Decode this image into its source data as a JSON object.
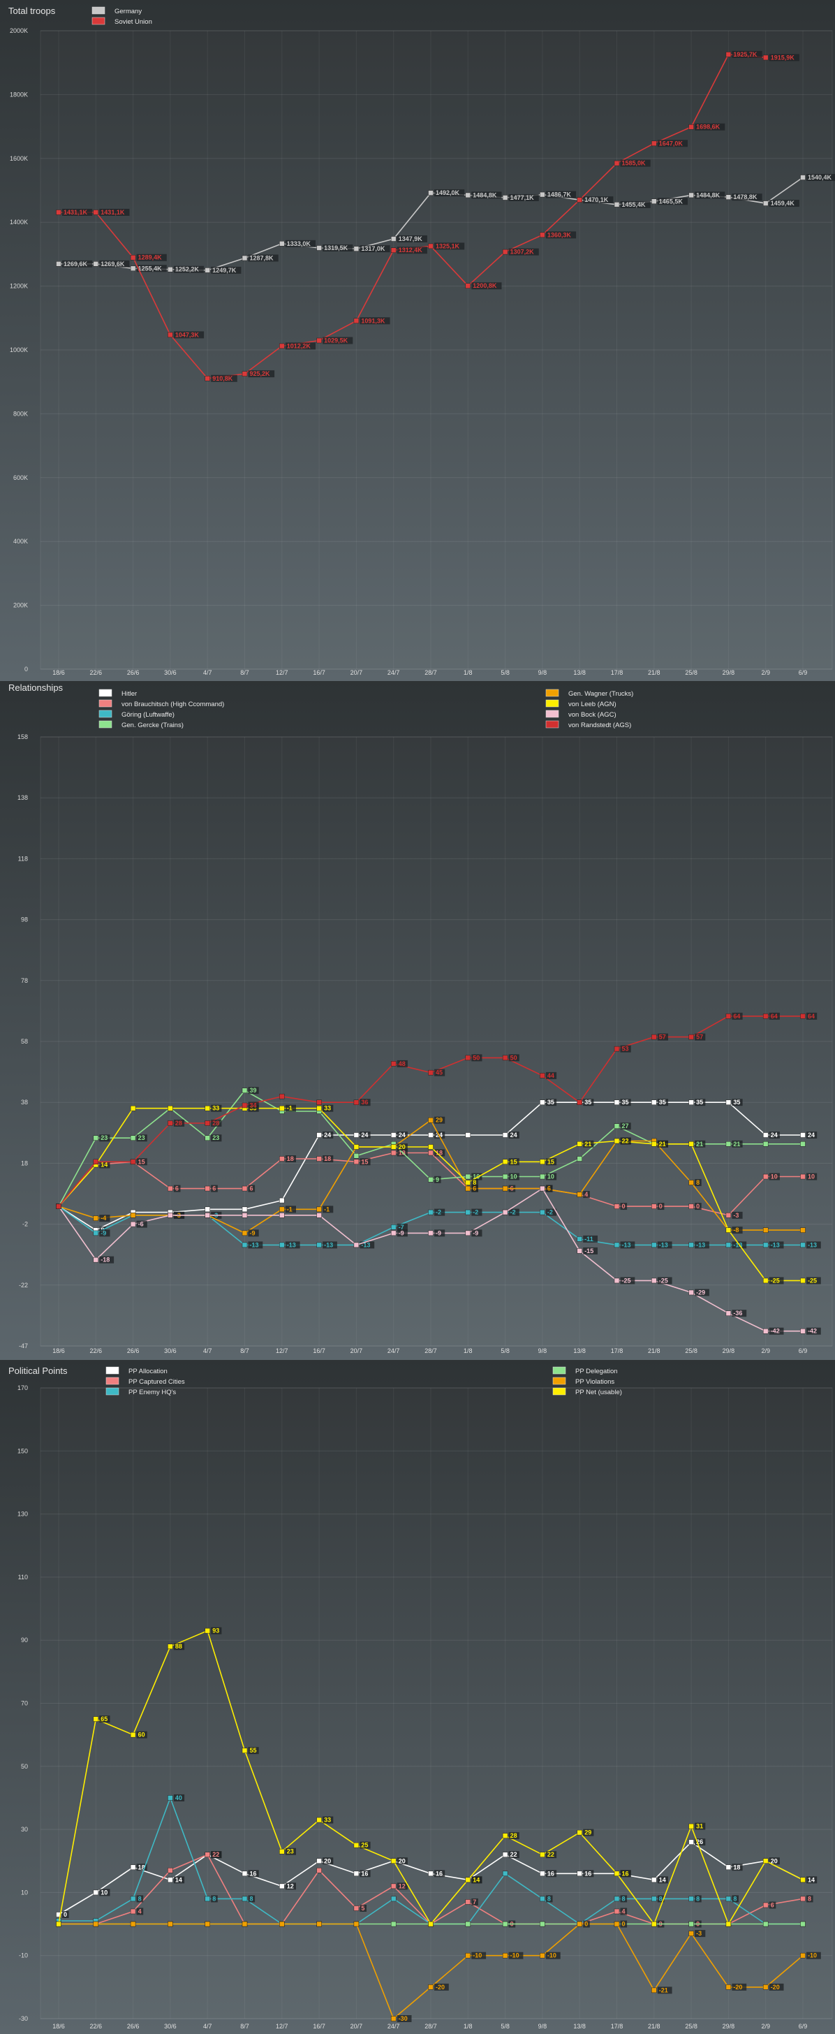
{
  "chart_data": [
    {
      "type": "line",
      "title": "Total troops",
      "categories": [
        "18/6",
        "22/6",
        "26/6",
        "30/6",
        "4/7",
        "8/7",
        "12/7",
        "16/7",
        "20/7",
        "24/7",
        "28/7",
        "1/8",
        "5/8",
        "9/8",
        "13/8",
        "17/8",
        "21/8",
        "25/8",
        "29/8",
        "2/9",
        "6/9"
      ],
      "y_ticks": [
        "2000K",
        "1800K",
        "1600K",
        "1400K",
        "1200K",
        "1000K",
        "800K",
        "600K",
        "400K",
        "200K",
        "0"
      ],
      "ylim": [
        0,
        2000
      ],
      "legend_position": "top-left",
      "series": [
        {
          "name": "Germany",
          "color": "#c8c8c8",
          "values": [
            1269.6,
            1269.6,
            1255.4,
            1252.2,
            1249.7,
            1287.8,
            1333.0,
            1319.5,
            1317.0,
            1347.9,
            1492.0,
            1484.8,
            1477.1,
            1486.7,
            1470.1,
            1455.4,
            1465.5,
            1484.8,
            1478.8,
            1459.4,
            1540.4
          ],
          "labels": [
            "1269,6K",
            "1269,6K",
            "1255,4K",
            "1252,2K",
            "1249,7K",
            "1287,8K",
            "1333,0K",
            "1319,5K",
            "1317,0K",
            "1347,9K",
            "1492,0K",
            "1484,8K",
            "1477,1K",
            "1486,7K",
            "1470,1K",
            "1455,4K",
            "1465,5K",
            "1484,8K",
            "1478,8K",
            "1459,4K",
            "1540,4K"
          ]
        },
        {
          "name": "Soviet Union",
          "color": "#d93a3a",
          "values": [
            1431.1,
            1431.1,
            1289.4,
            1047.3,
            910.8,
            925.2,
            1012.2,
            1029.5,
            1091.3,
            1312.4,
            1325.1,
            1200.8,
            1307.2,
            1360.3,
            1470.1,
            1585.0,
            1647.0,
            1698.6,
            1925.7,
            1915.9,
            null
          ],
          "labels": [
            "1431,1K",
            "1431,1K",
            "1289,4K",
            "1047,3K",
            "910,8K",
            "925,2K",
            "1012,2K",
            "1029,5K",
            "1091,3K",
            "1312,4K",
            "1325,1K",
            "1200,8K",
            "1307,2K",
            "1360,3K",
            "",
            "1585,0K",
            "1647,0K",
            "1698,6K",
            "1925,7K",
            "1915,9K",
            ""
          ]
        }
      ]
    },
    {
      "type": "line",
      "title": "Relationships",
      "categories": [
        "18/6",
        "22/6",
        "26/6",
        "30/6",
        "4/7",
        "8/7",
        "12/7",
        "16/7",
        "20/7",
        "24/7",
        "28/7",
        "1/8",
        "5/8",
        "9/8",
        "13/8",
        "17/8",
        "21/8",
        "25/8",
        "29/8",
        "2/9",
        "6/9"
      ],
      "y_ticks": [
        "158",
        "138",
        "118",
        "98",
        "78",
        "58",
        "38",
        "18",
        "-2",
        "-22",
        "-47"
      ],
      "ylim": [
        -47,
        158
      ],
      "legend_position": "top",
      "series": [
        {
          "name": "Hitler",
          "color": "#ffffff",
          "values": [
            0,
            -8,
            -2,
            -2,
            -1,
            -1,
            2,
            24,
            24,
            24,
            24,
            24,
            24,
            35,
            35,
            35,
            35,
            35,
            35,
            24,
            24
          ],
          "labels": [
            "",
            "8",
            "",
            "",
            "",
            "",
            "",
            "24",
            "24",
            "24",
            "24",
            "",
            "24",
            "35",
            "35",
            "35",
            "35",
            "35",
            "35",
            "24",
            "24"
          ]
        },
        {
          "name": "von Brauchitsch (High Ccommand)",
          "color": "#f08080",
          "values": [
            0,
            14,
            15,
            6,
            6,
            6,
            16,
            16,
            15,
            18,
            18,
            6,
            6,
            6,
            4,
            0,
            0,
            0,
            -3,
            10,
            10
          ],
          "labels": [
            "",
            "",
            "15",
            "6",
            "6",
            "6",
            "18",
            "18",
            "15",
            "18",
            "18",
            "6",
            "6",
            "6",
            "4",
            "0",
            "0",
            "0",
            "-3",
            "10",
            "10"
          ]
        },
        {
          "name": "Göring (Luftwaffe)",
          "color": "#3fb9c5",
          "values": [
            0,
            -9,
            -3,
            -3,
            -3,
            -13,
            -13,
            -13,
            -13,
            -7,
            -2,
            -2,
            -2,
            -2,
            -11,
            -13,
            -13,
            -13,
            -13,
            -13,
            -13
          ],
          "labels": [
            "",
            "-9",
            "",
            "-3",
            "-3",
            "-13",
            "-13",
            "-13",
            "-13",
            "-7",
            "-2",
            "-2",
            "-2",
            "-2",
            "-11",
            "-13",
            "-13",
            "-13",
            "-13",
            "-13",
            "-13"
          ]
        },
        {
          "name": "Gen. Gercke (Trains)",
          "color": "#8ee28e",
          "values": [
            0,
            23,
            23,
            33,
            23,
            39,
            32,
            32,
            17,
            21,
            9,
            10,
            10,
            10,
            16,
            27,
            21,
            21,
            21,
            21,
            21
          ],
          "labels": [
            "",
            "23",
            "23",
            "",
            "23",
            "39",
            "",
            "",
            "",
            "",
            "9",
            "10",
            "10",
            "10",
            "",
            "27",
            "21",
            "21",
            "21",
            "",
            ""
          ]
        },
        {
          "name": "Gen. Wagner (Trucks)",
          "color": "#f0a000",
          "values": [
            0,
            -4,
            -3,
            -3,
            -3,
            -9,
            -1,
            -1,
            20,
            20,
            29,
            6,
            6,
            6,
            4,
            22,
            22,
            8,
            -8,
            -8,
            -8
          ],
          "labels": [
            "",
            "-4",
            "",
            "-3",
            "",
            "-9",
            "-1",
            "-1",
            "",
            "",
            "29",
            "6",
            "",
            "6",
            "",
            "22",
            "",
            "8",
            "-8",
            "",
            ""
          ]
        },
        {
          "name": "von Leeb (AGN)",
          "color": "#ffee00",
          "values": [
            0,
            14,
            33,
            33,
            33,
            33,
            33,
            33,
            20,
            20,
            20,
            8,
            15,
            15,
            21,
            22,
            21,
            21,
            -8,
            -25,
            -25
          ],
          "labels": [
            "",
            "14",
            "",
            "",
            "33",
            "33",
            "-1",
            "33",
            "",
            "20",
            "",
            "8",
            "15",
            "15",
            "21",
            "22",
            "21",
            "",
            "",
            "-25",
            "-25"
          ]
        },
        {
          "name": "von Bock (AGC)",
          "color": "#f2c0d0",
          "values": [
            0,
            -18,
            -6,
            -3,
            -3,
            -3,
            -3,
            -3,
            -13,
            -9,
            -9,
            -9,
            -2,
            6,
            -15,
            -25,
            -25,
            -29,
            -36,
            -42,
            -42
          ],
          "labels": [
            "",
            "-18",
            "-6",
            "",
            "",
            "",
            "",
            "",
            "",
            "-9",
            "-9",
            "-9",
            "",
            "",
            "-15",
            "-25",
            "-25",
            "-29",
            "-36",
            "-42",
            "-42"
          ]
        },
        {
          "name": "von Randstedt (AGS)",
          "color": "#d03030",
          "values": [
            0,
            15,
            15,
            28,
            28,
            34,
            37,
            35,
            35,
            48,
            45,
            50,
            50,
            44,
            35,
            53,
            57,
            57,
            64,
            64,
            64
          ],
          "labels": [
            "",
            "",
            "",
            "28",
            "28",
            "34",
            "",
            "",
            "36",
            "48",
            "45",
            "50",
            "50",
            "44",
            "",
            "53",
            "57",
            "57",
            "64",
            "64",
            "64"
          ]
        }
      ]
    },
    {
      "type": "line",
      "title": "Political Points",
      "categories": [
        "18/6",
        "22/6",
        "26/6",
        "30/6",
        "4/7",
        "8/7",
        "12/7",
        "16/7",
        "20/7",
        "24/7",
        "28/7",
        "1/8",
        "5/8",
        "9/8",
        "13/8",
        "17/8",
        "21/8",
        "25/8",
        "29/8",
        "2/9",
        "6/9"
      ],
      "y_ticks": [
        "170",
        "150",
        "130",
        "110",
        "90",
        "70",
        "50",
        "30",
        "10",
        "-10",
        "-30"
      ],
      "ylim": [
        -30,
        170
      ],
      "legend_position": "top",
      "series": [
        {
          "name": "PP Allocation",
          "color": "#ffffff",
          "values": [
            3,
            10,
            18,
            14,
            22,
            16,
            12,
            20,
            16,
            20,
            16,
            14,
            22,
            16,
            16,
            16,
            14,
            26,
            18,
            20,
            14
          ],
          "labels": [
            "0",
            "10",
            "18",
            "14",
            "22",
            "16",
            "12",
            "20",
            "16",
            "20",
            "16",
            "14",
            "22",
            "16",
            "16",
            "16",
            "14",
            "26",
            "18",
            "20",
            "14"
          ]
        },
        {
          "name": "PP Captured Cities",
          "color": "#f08080",
          "values": [
            0,
            0,
            4,
            17,
            22,
            0,
            0,
            17,
            5,
            12,
            0,
            7,
            0,
            0,
            0,
            4,
            0,
            0,
            0,
            6,
            8
          ],
          "labels": [
            "",
            "",
            "4",
            "",
            "22",
            "",
            "",
            "",
            "5",
            "12",
            "",
            "7",
            "0",
            "",
            "",
            "4",
            "0",
            "0",
            "",
            "6",
            "8"
          ]
        },
        {
          "name": "PP Enemy HQ's",
          "color": "#3fb9c5",
          "values": [
            1,
            1,
            8,
            40,
            8,
            8,
            0,
            0,
            0,
            8,
            0,
            0,
            16,
            8,
            0,
            8,
            8,
            8,
            8,
            0,
            0
          ],
          "labels": [
            "",
            "",
            "8",
            "40",
            "8",
            "8",
            "",
            "",
            "",
            "",
            "",
            "",
            "",
            "8",
            "",
            "8",
            "8",
            "8",
            "8",
            "",
            ""
          ]
        },
        {
          "name": "PP Delegation",
          "color": "#8ee28e",
          "values": [
            0,
            0,
            0,
            0,
            0,
            0,
            0,
            0,
            0,
            0,
            0,
            0,
            0,
            0,
            0,
            0,
            0,
            0,
            0,
            0,
            0
          ],
          "labels": [
            "",
            "",
            "",
            "",
            "",
            "",
            "",
            "",
            "",
            "",
            "",
            "",
            "",
            "",
            "",
            "",
            "",
            "",
            "",
            "",
            ""
          ]
        },
        {
          "name": "PP Violations",
          "color": "#f0a000",
          "values": [
            0,
            0,
            0,
            0,
            0,
            0,
            0,
            0,
            0,
            -30,
            -20,
            -10,
            -10,
            -10,
            0,
            0,
            -21,
            -3,
            -20,
            -20,
            -10
          ],
          "labels": [
            "",
            "",
            "",
            "",
            "",
            "",
            "",
            "",
            "",
            "-30",
            "-20",
            "-10",
            "-10",
            "-10",
            "0",
            "0",
            "-21",
            "-3",
            "-20",
            "-20",
            "-10"
          ]
        },
        {
          "name": "PP Net (usable)",
          "color": "#ffee00",
          "values": [
            0,
            65,
            60,
            88,
            93,
            55,
            23,
            33,
            25,
            20,
            0,
            14,
            28,
            22,
            29,
            16,
            0,
            31,
            0,
            20,
            14
          ],
          "labels": [
            "",
            "65",
            "60",
            "88",
            "93",
            "55",
            "23",
            "33",
            "25",
            "",
            "",
            "14",
            "28",
            "22",
            "29",
            "16",
            "",
            "31",
            "",
            "",
            ""
          ]
        }
      ]
    }
  ]
}
